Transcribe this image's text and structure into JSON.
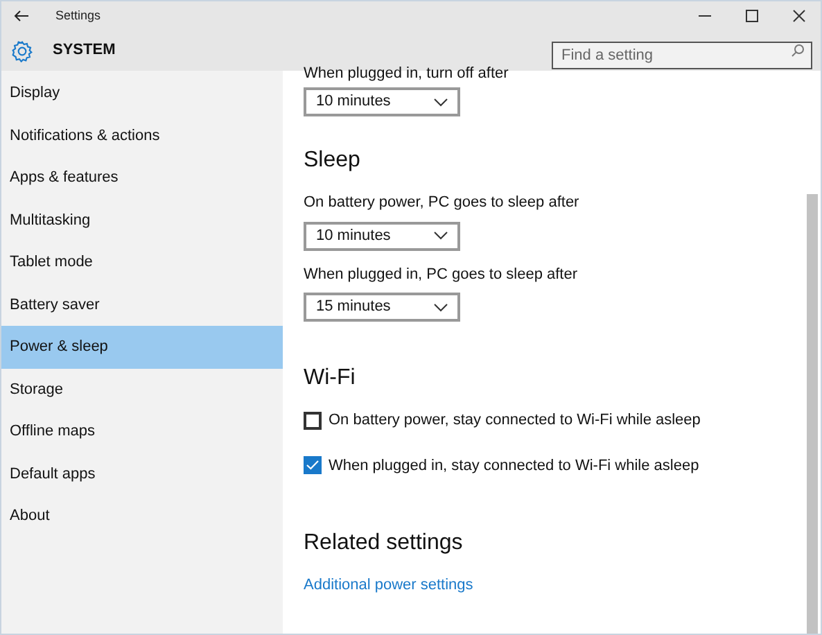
{
  "window": {
    "title": "Settings"
  },
  "header": {
    "title": "SYSTEM",
    "search": {
      "placeholder": "Find a setting"
    }
  },
  "sidebar": {
    "items": [
      {
        "label": "Display",
        "selected": false
      },
      {
        "label": "Notifications & actions",
        "selected": false
      },
      {
        "label": "Apps & features",
        "selected": false
      },
      {
        "label": "Multitasking",
        "selected": false
      },
      {
        "label": "Tablet mode",
        "selected": false
      },
      {
        "label": "Battery saver",
        "selected": false
      },
      {
        "label": "Power & sleep",
        "selected": true
      },
      {
        "label": "Storage",
        "selected": false
      },
      {
        "label": "Offline maps",
        "selected": false
      },
      {
        "label": "Default apps",
        "selected": false
      },
      {
        "label": "About",
        "selected": false
      }
    ]
  },
  "content": {
    "top_setting": {
      "label": "When plugged in, turn off after",
      "value": "10 minutes"
    },
    "sections": [
      {
        "title": "Sleep",
        "items": [
          {
            "kind": "dropdown",
            "label": "On battery power, PC goes to sleep after",
            "value": "10 minutes"
          },
          {
            "kind": "dropdown",
            "label": "When plugged in, PC goes to sleep after",
            "value": "15 minutes"
          }
        ]
      },
      {
        "title": "Wi-Fi",
        "items": [
          {
            "kind": "checkbox",
            "label": "On battery power, stay connected to Wi-Fi while asleep",
            "checked": false
          },
          {
            "kind": "checkbox",
            "label": "When plugged in, stay connected to Wi-Fi while asleep",
            "checked": true
          }
        ]
      },
      {
        "title": "Related settings",
        "items": [
          {
            "kind": "link",
            "label": "Additional power settings"
          }
        ]
      }
    ]
  }
}
